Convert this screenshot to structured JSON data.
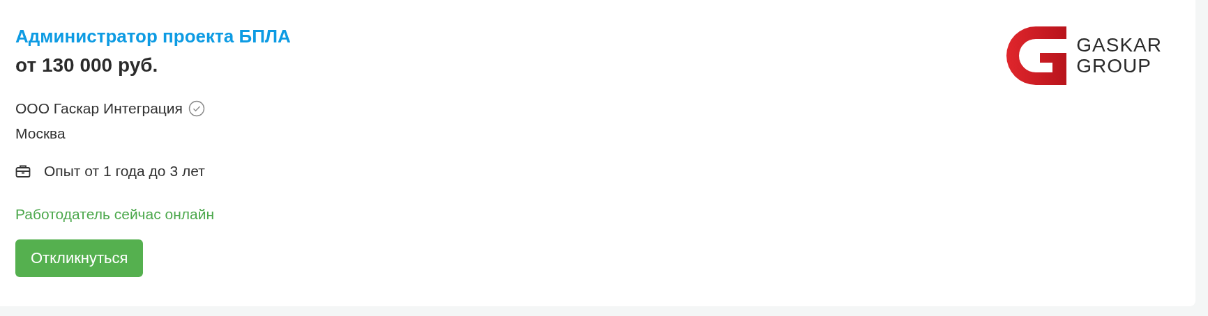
{
  "vacancy": {
    "title": "Администратор проекта БПЛА",
    "salary": "от 130 000 руб.",
    "company": {
      "name": "ООО Гаскар Интеграция",
      "verified": true
    },
    "city": "Москва",
    "experience": "Опыт от 1 года до 3 лет",
    "online_status": "Работодатель сейчас онлайн",
    "apply_button": "Откликнуться",
    "logo": {
      "lines": [
        "GASKAR",
        "GROUP"
      ]
    }
  }
}
